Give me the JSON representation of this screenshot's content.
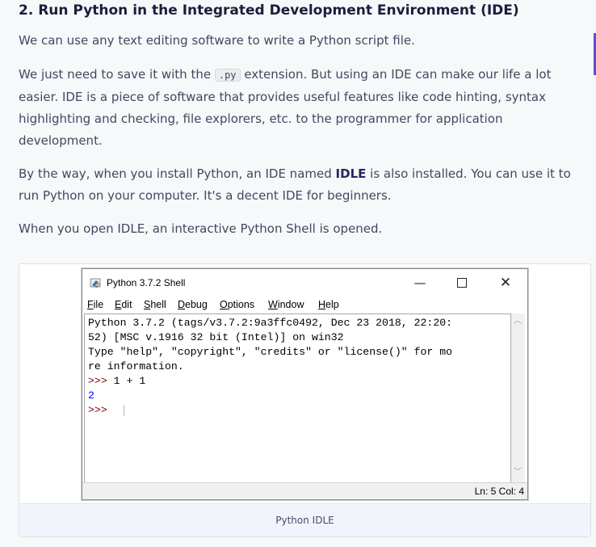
{
  "heading": "2. Run Python in the Integrated Development Environment (IDE)",
  "p1": "We can use any text editing software to write a Python script file.",
  "p2": {
    "before": "We just need to save it with the",
    "code": ".py",
    "after": "extension. But using an IDE can make our life a lot easier. IDE is a piece of software that provides useful features like code hinting, syntax highlighting and checking, file explorers, etc. to the programmer for application development."
  },
  "p3": {
    "before": "By the way, when you install Python, an IDE named",
    "bold": "IDLE",
    "after": "is also installed. You can use it to run Python on your computer. It's a decent IDE for beginners."
  },
  "p4": "When you open IDLE, an interactive Python Shell is opened.",
  "idle": {
    "window_title": "Python 3.7.2 Shell",
    "menu": [
      "File",
      "Edit",
      "Shell",
      "Debug",
      "Options",
      "Window",
      "Help"
    ],
    "menu_underline": [
      "F",
      "E",
      "S",
      "D",
      "O",
      "W",
      "H"
    ],
    "shell_line1": "Python 3.7.2 (tags/v3.7.2:9a3ffc0492, Dec 23 2018, 22:20:",
    "shell_line2": "52) [MSC v.1916 32 bit (Intel)] on win32",
    "shell_line3": "Type \"help\", \"copyright\", \"credits\" or \"license()\" for mo",
    "shell_line4": "re information.",
    "prompt": ">>>",
    "input": " 1 + 1",
    "output": "2",
    "prompt2": ">>>",
    "status": "Ln: 5  Col: 4"
  },
  "caption": "Python IDLE"
}
